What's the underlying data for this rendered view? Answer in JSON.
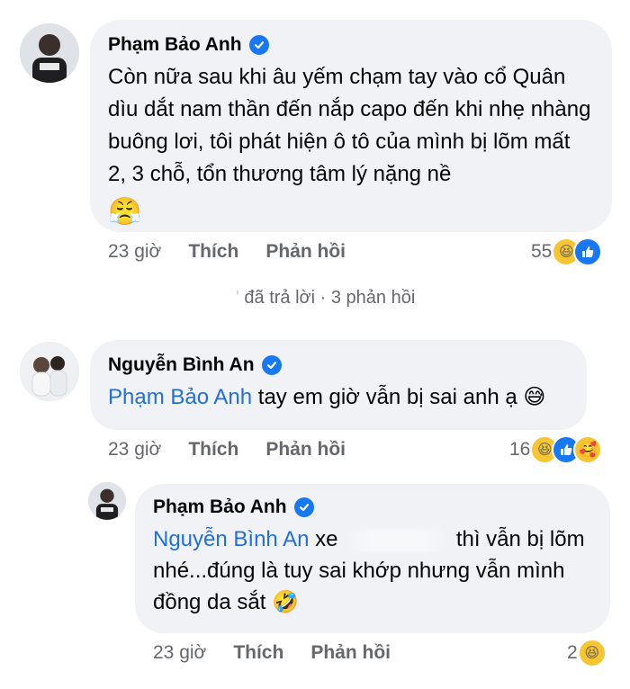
{
  "comment1": {
    "author": "Phạm Bảo Anh",
    "text": "Còn nữa sau khi âu yếm chạm tay vào cổ Quân dìu dắt nam thần đến nắp capo đến khi nhẹ nhàng buông lơi, tôi phát hiện ô tô của mình bị lõm mất 2, 3 chỗ, tổn thương tâm lý nặng nề",
    "emoji": "😤",
    "time": "23 giờ",
    "like_label": "Thích",
    "reply_label": "Phản hồi",
    "reaction_count": "55"
  },
  "replies_summary": {
    "text": "đã trả lời · 3 phản hồi"
  },
  "comment2": {
    "author": "Nguyễn Bình An",
    "mention": "Phạm Bảo Anh",
    "text": " tay em giờ vẫn bị sai anh ạ ",
    "emoji": "😅",
    "time": "23 giờ",
    "like_label": "Thích",
    "reply_label": "Phản hồi",
    "reaction_count": "16"
  },
  "comment3": {
    "author": "Phạm Bảo Anh",
    "mention": "Nguyễn Bình An",
    "text_part1": " xe",
    "text_part2": "thì vẫn bị lõm",
    "text_line2": "nhé...đúng là tuy sai khớp nhưng vẫn mình",
    "text_line3": "đồng da sắt ",
    "emoji": "🤣",
    "time": "23 giờ",
    "like_label": "Thích",
    "reply_label": "Phản hồi",
    "reaction_count": "2"
  },
  "colors": {
    "bubble": "#f0f2f5",
    "mention": "#216fdb",
    "meta": "#65676b",
    "verified": "#1877f2"
  }
}
